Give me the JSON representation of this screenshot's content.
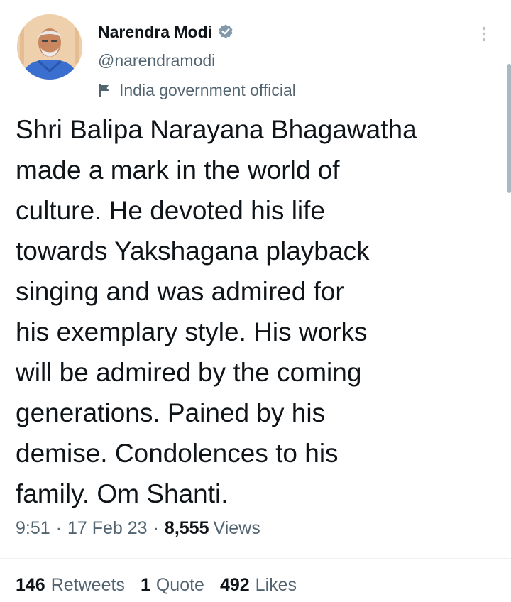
{
  "author": {
    "display_name": "Narendra Modi",
    "handle": "@narendramodi",
    "label": "India government official",
    "verified": true,
    "verified_color": "#829aab"
  },
  "tweet": {
    "text": "Shri Balipa Narayana Bhagawatha\nmade a mark in the world of\nculture. He devoted his life\ntowards Yakshagana playback\nsinging and was admired for\nhis exemplary style. His works\nwill be admired by the coming\ngenerations. Pained by his\ndemise. Condolences to his\nfamily. Om Shanti.",
    "time": "9:51",
    "date": "17 Feb 23",
    "separator": "·",
    "views_count": "8,555",
    "views_label": "Views"
  },
  "stats": {
    "retweets_count": "146",
    "retweets_label": "Retweets",
    "quotes_count": "1",
    "quotes_label": "Quote",
    "likes_count": "492",
    "likes_label": "Likes"
  },
  "icons": {
    "verified": "verified-badge-icon",
    "government_label": "flag-icon",
    "more": "more-options-icon"
  }
}
